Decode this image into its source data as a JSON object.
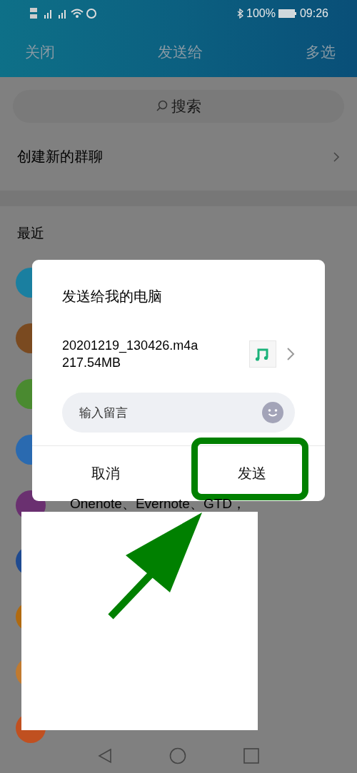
{
  "status_bar": {
    "battery": "100%",
    "time": "09:26"
  },
  "header": {
    "close": "关闭",
    "title": "发送给",
    "multi_select": "多选"
  },
  "search": {
    "placeholder": "搜索"
  },
  "new_group": {
    "label": "创建新的群聊"
  },
  "section": {
    "title": "最近"
  },
  "recent": [
    {
      "color": "#1a7fa0"
    },
    {
      "color": "#7a4a20"
    },
    {
      "color": "#4a8a30"
    },
    {
      "color": "#2a6ab0"
    },
    {
      "color": "#6a3070",
      "text": "Onenote、Evernote、GTD，"
    },
    {
      "color": "#1f4a90"
    },
    {
      "color": "#b06a10"
    },
    {
      "color": "#c07a30"
    },
    {
      "color": "#c05020"
    }
  ],
  "dialog": {
    "title": "发送给我的电脑",
    "file_name": "20201219_130426.m4a",
    "file_size": "217.54MB",
    "message": {
      "placeholder": "输入留言"
    },
    "cancel": "取消",
    "send": "发送",
    "send_highlighted": true
  }
}
